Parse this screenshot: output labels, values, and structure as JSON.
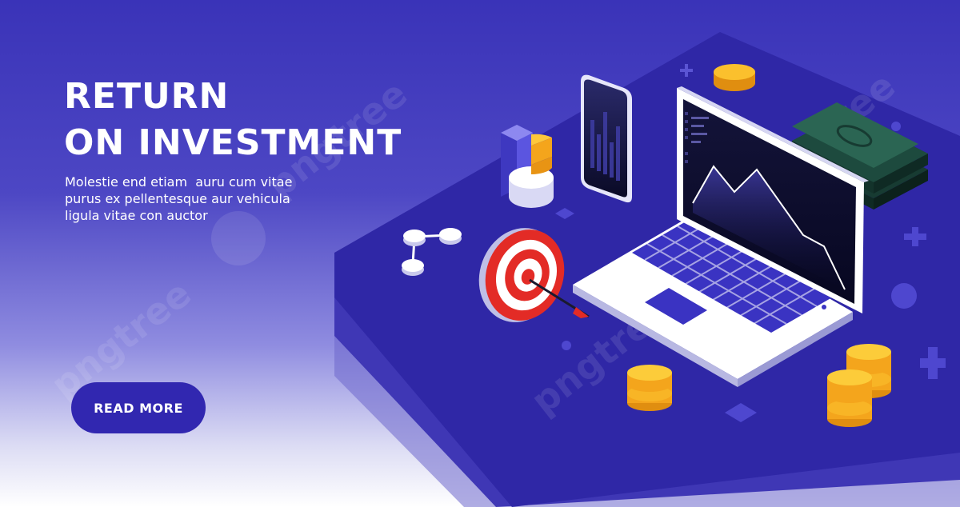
{
  "hero": {
    "title_line_1": "RETURN",
    "title_line_2": "ON INVESTMENT",
    "description_lines": [
      "Molestie end etiam  auru cum vitae",
      "purus ex pellentesque aur vehicula",
      "ligula vitae con auctor"
    ],
    "cta_label": "READ MORE"
  },
  "watermark": "pngtree",
  "colors": {
    "brand_blue": "#3127b0",
    "platform": "#3126a8",
    "coin": "#f9b915",
    "target_red": "#e32b26",
    "screen": "#0b0b2e"
  },
  "icons": [
    "laptop-icon",
    "smartphone-icon",
    "pie-chart-icon",
    "target-icon",
    "coin-stack-icon",
    "banknote-stack-icon",
    "network-icon",
    "plus-icon"
  ]
}
